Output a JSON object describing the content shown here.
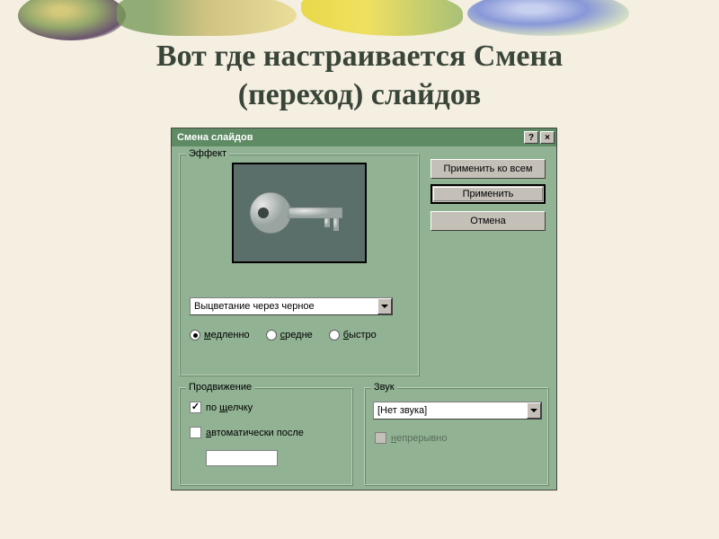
{
  "title_line1": "Вот где настраивается Смена",
  "title_line2": "(переход) слайдов",
  "dialog": {
    "title": "Смена слайдов",
    "help": "?",
    "close": "×",
    "effect": {
      "label": "Эффект",
      "selected": "Выцветание через черное",
      "speed": {
        "slow": "медленно",
        "medium": "средне",
        "fast": "быстро",
        "value": "slow"
      }
    },
    "advance": {
      "label": "Продвижение",
      "on_click": "по щелчку",
      "auto_after": "автоматически после",
      "on_click_checked": true,
      "auto_checked": false,
      "auto_value": ""
    },
    "sound": {
      "label": "Звук",
      "selected": "[Нет звука]",
      "loop": "непрерывно"
    },
    "buttons": {
      "apply_all": "Применить ко всем",
      "apply": "Применить",
      "cancel": "Отмена"
    }
  }
}
